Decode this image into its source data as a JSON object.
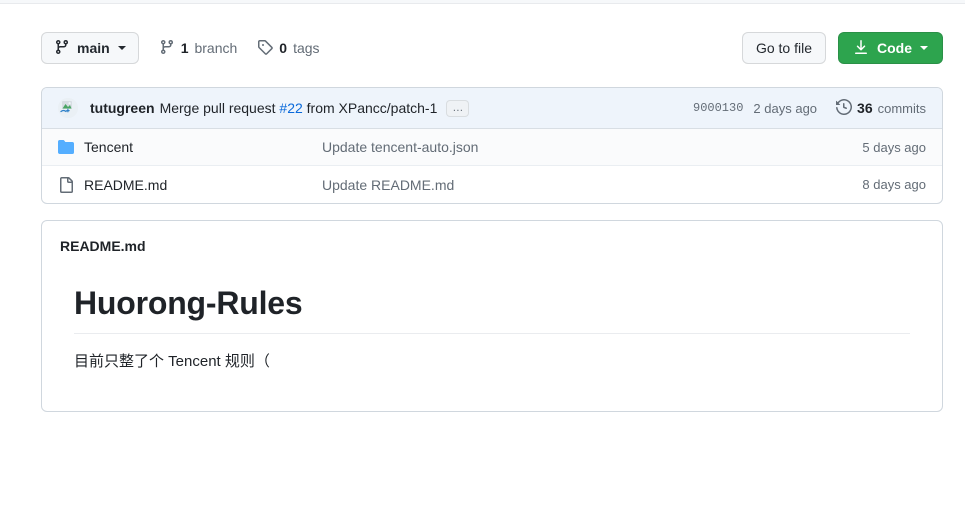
{
  "toolbar": {
    "branch_name": "main",
    "branch_count_label": "branch",
    "branch_count": "1",
    "tag_count": "0",
    "tag_count_label": "tags",
    "go_to_file_label": "Go to file",
    "code_label": "Code"
  },
  "commit": {
    "author": "tutugreen",
    "message_prefix": "Merge pull request ",
    "pr_number": "#22",
    "message_suffix": " from XPancc/patch-1",
    "ellipsis_label": "…",
    "sha": "9000130",
    "relative_time": "2 days ago",
    "commits_count": "36",
    "commits_label": "commits"
  },
  "files": [
    {
      "icon": "folder-icon",
      "name": "Tencent",
      "commit_message": "Update tencent-auto.json",
      "updated": "5 days ago"
    },
    {
      "icon": "file-icon",
      "name": "README.md",
      "commit_message": "Update README.md",
      "updated": "8 days ago"
    }
  ],
  "readme": {
    "header": "README.md",
    "title": "Huorong-Rules",
    "paragraph": "目前只整了个 Tencent 规则（"
  },
  "colors": {
    "accent_green": "#2da44e",
    "link_blue": "#0969da",
    "commit_row_bg": "#eef4fb",
    "border": "#d0d7de",
    "muted_text": "#636c76",
    "folder_blue": "#54aeff"
  }
}
